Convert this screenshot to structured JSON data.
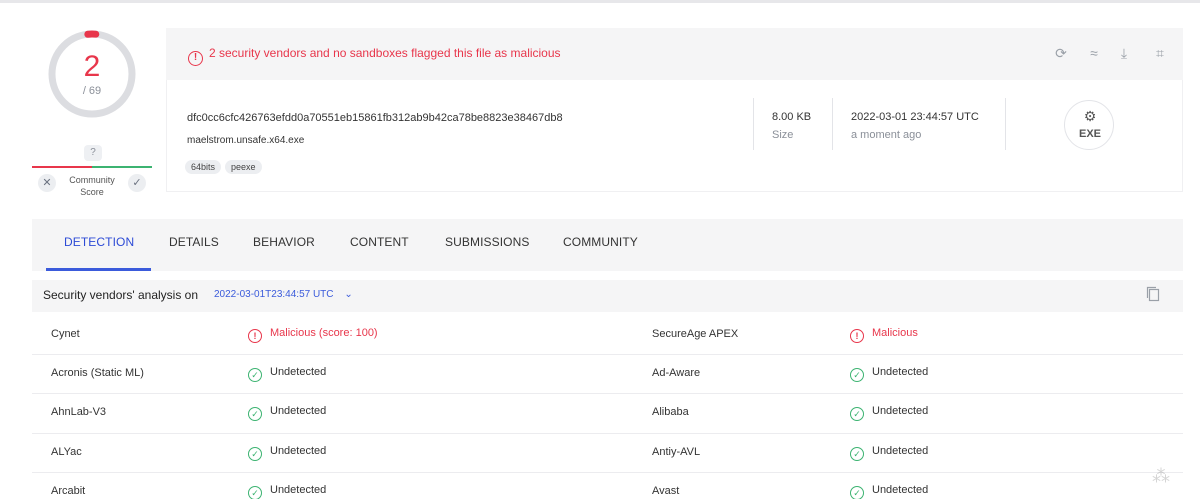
{
  "score": {
    "detections": "2",
    "total": "/ 69"
  },
  "community": {
    "question": "?",
    "label_line1": "Community",
    "label_line2": "Score"
  },
  "alert": {
    "text": "2 security vendors and no sandboxes flagged this file as malicious",
    "icon": "!"
  },
  "toolbar_icons": [
    "reanalyze-icon",
    "similar-icon",
    "download-icon",
    "graph-icon"
  ],
  "file": {
    "hash": "dfc0cc6cfc426763efdd0a70551eb15861fb312ab9b42ca78be8823e38467db8",
    "name": "maelstrom.unsafe.x64.exe",
    "tags": [
      "64bits",
      "peexe"
    ],
    "size_value": "8.00 KB",
    "size_label": "Size",
    "date_value": "2022-03-01 23:44:57 UTC",
    "date_label": "a moment ago",
    "type_label": "EXE"
  },
  "tabs": [
    "DETECTION",
    "DETAILS",
    "BEHAVIOR",
    "CONTENT",
    "SUBMISSIONS",
    "COMMUNITY"
  ],
  "analysis": {
    "title": "Security vendors' analysis on",
    "date": "2022-03-01T23:44:57 UTC",
    "chevron": "⌄"
  },
  "vendors": [
    {
      "left": "Cynet",
      "left_result": "Malicious (score: 100)",
      "left_status": "malicious",
      "right": "SecureAge APEX",
      "right_result": "Malicious",
      "right_status": "malicious"
    },
    {
      "left": "Acronis (Static ML)",
      "left_result": "Undetected",
      "left_status": "undetected",
      "right": "Ad-Aware",
      "right_result": "Undetected",
      "right_status": "undetected"
    },
    {
      "left": "AhnLab-V3",
      "left_result": "Undetected",
      "left_status": "undetected",
      "right": "Alibaba",
      "right_result": "Undetected",
      "right_status": "undetected"
    },
    {
      "left": "ALYac",
      "left_result": "Undetected",
      "left_status": "undetected",
      "right": "Antiy-AVL",
      "right_result": "Undetected",
      "right_status": "undetected"
    },
    {
      "left": "Arcabit",
      "left_result": "Undetected",
      "left_status": "undetected",
      "right": "Avast",
      "right_result": "Undetected",
      "right_status": "undetected"
    }
  ],
  "colors": {
    "malicious": "#e8364b",
    "undetected": "#3cb371",
    "accent": "#3b5bdb"
  }
}
